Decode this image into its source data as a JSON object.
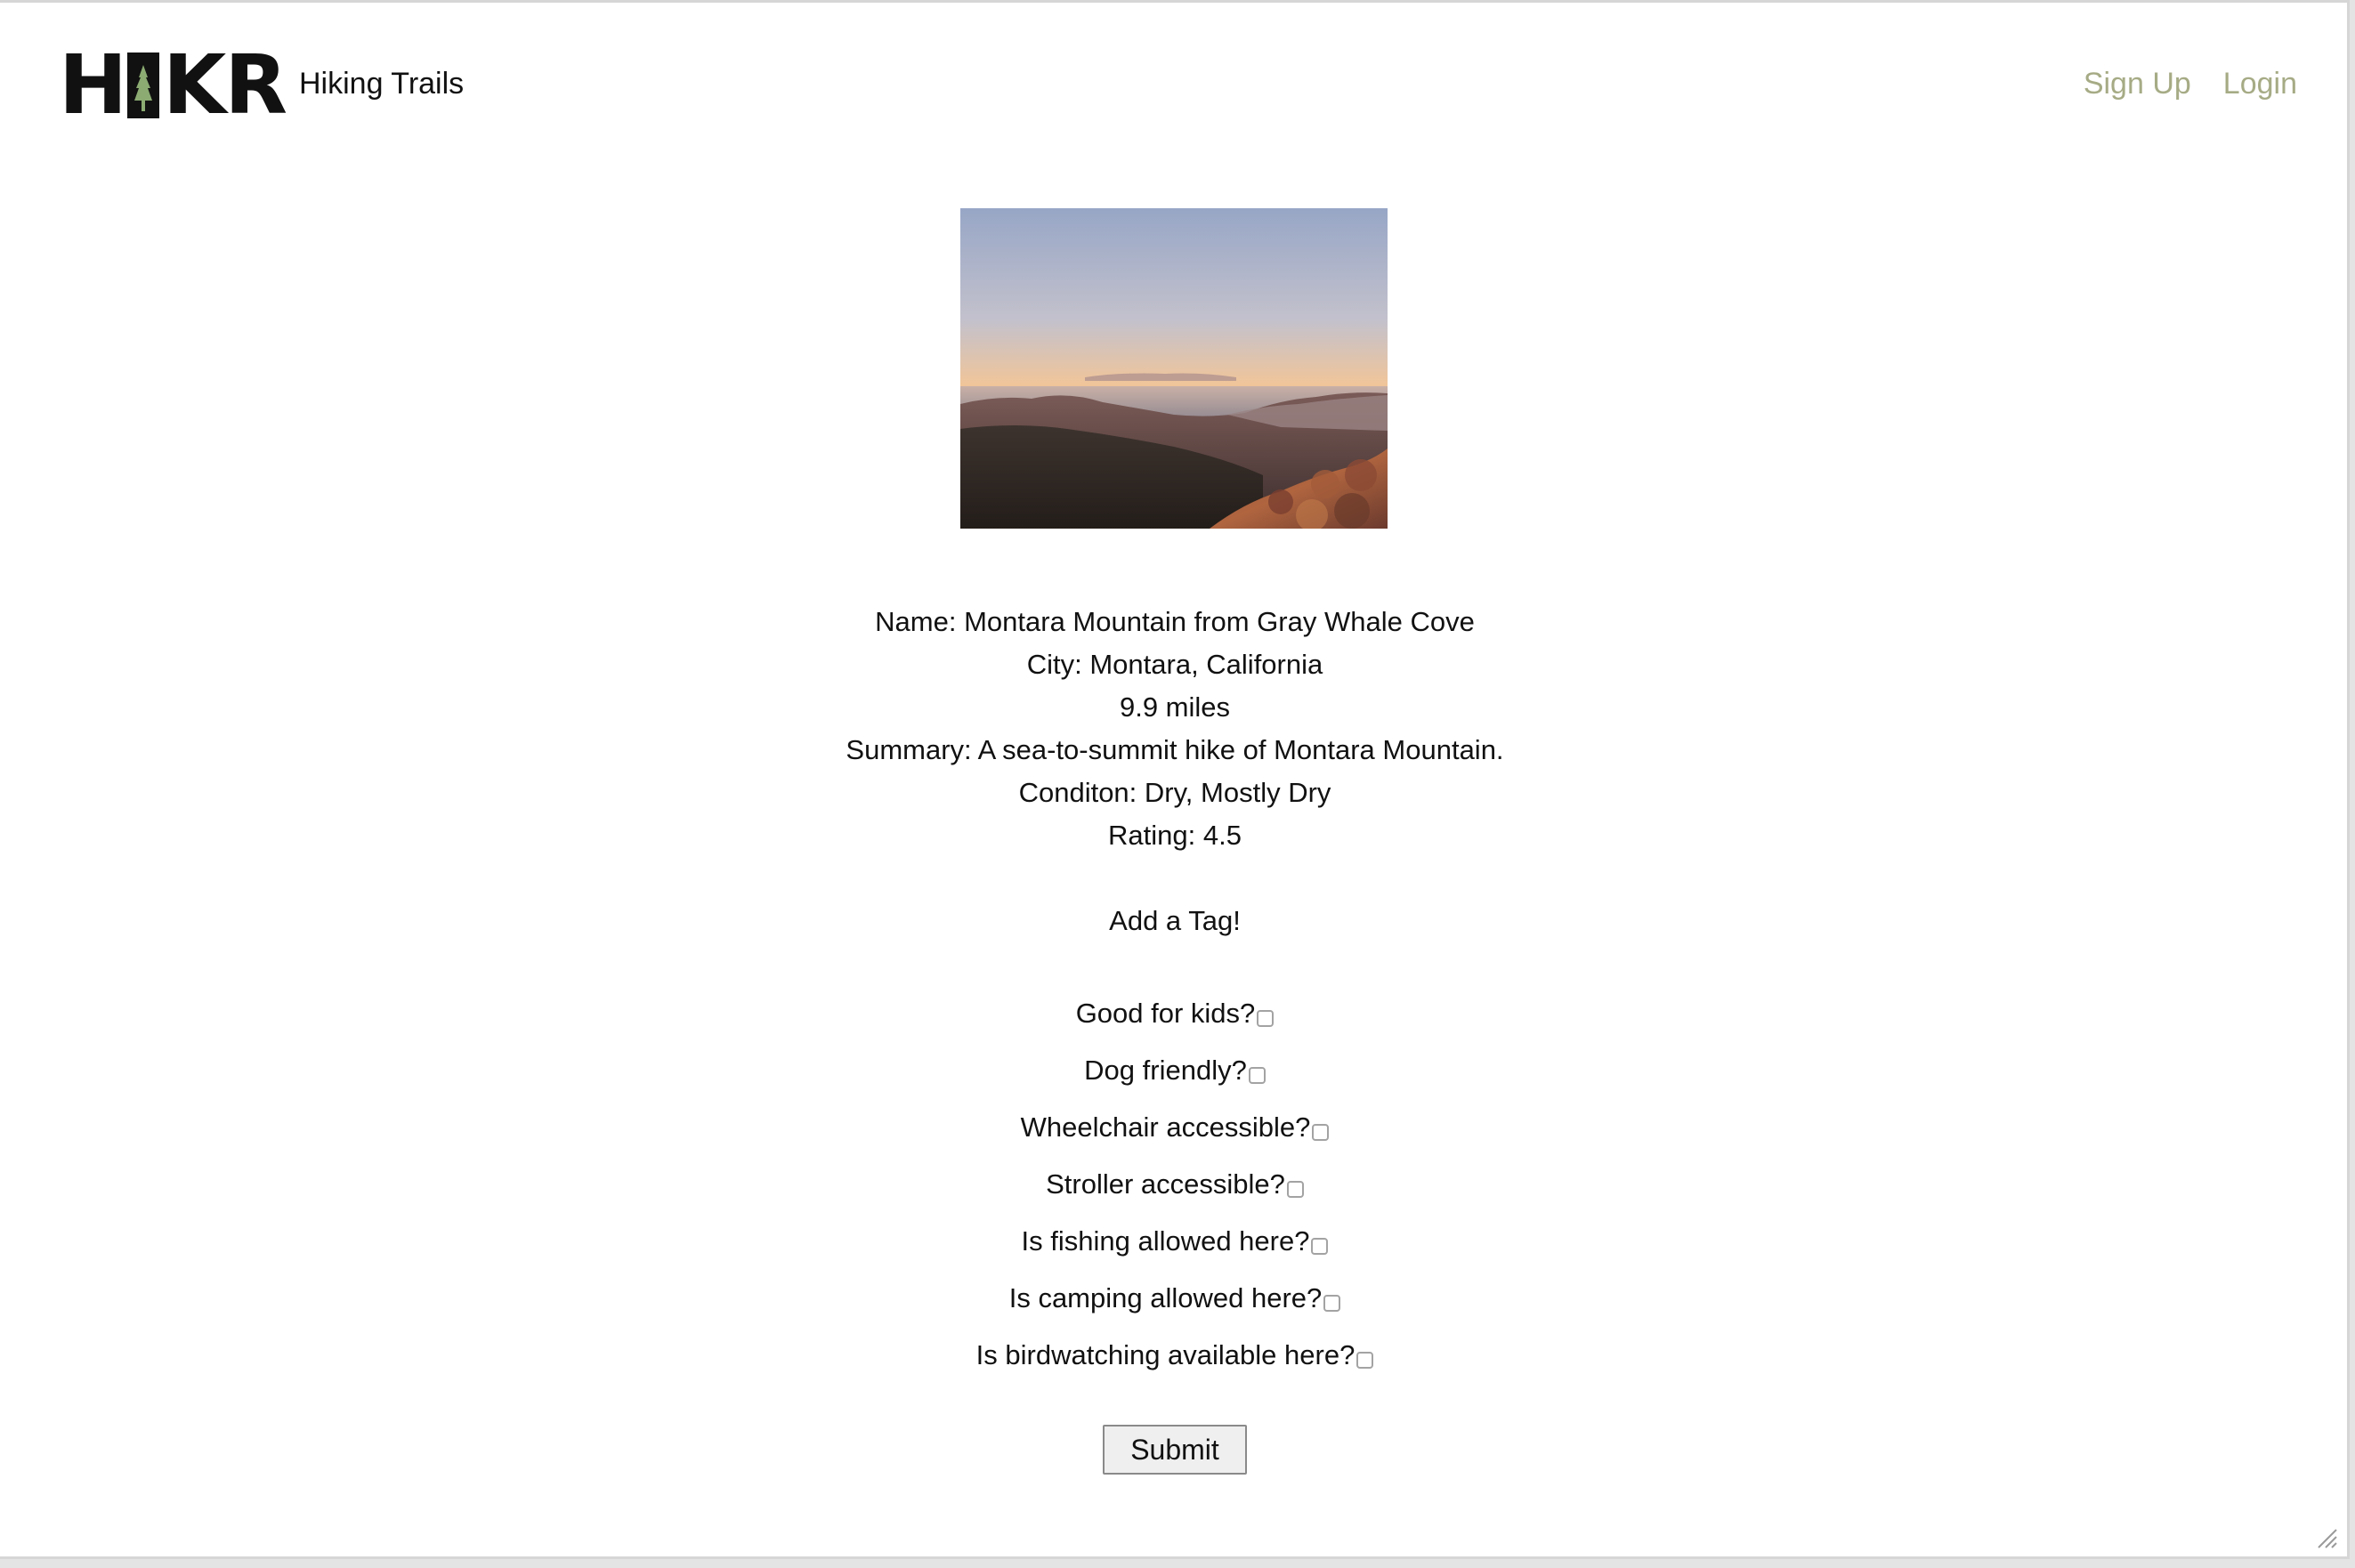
{
  "header": {
    "logo_letters": [
      "H",
      "I",
      "K",
      "R"
    ],
    "site_title": "Hiking Trails",
    "nav": {
      "signup": "Sign Up",
      "login": "Login"
    },
    "accent_color": "#a6ab85",
    "logo_tree_color": "#8bab72"
  },
  "trail": {
    "photo_icon": "sunset-landscape-image",
    "name_line": "Name: Montara Mountain from Gray Whale Cove",
    "city_line": "City: Montara, California",
    "distance_line": "9.9 miles",
    "summary_line": "Summary: A sea-to-summit hike of Montara Mountain.",
    "condition_line": "Conditon: Dry, Mostly Dry",
    "rating_line": "Rating: 4.5"
  },
  "tags": {
    "heading": "Add a Tag!",
    "options": [
      {
        "label": "Good for kids?",
        "checked": false
      },
      {
        "label": "Dog friendly?",
        "checked": false
      },
      {
        "label": "Wheelchair accessible?",
        "checked": false
      },
      {
        "label": "Stroller accessible?",
        "checked": false
      },
      {
        "label": "Is fishing allowed here?",
        "checked": false
      },
      {
        "label": "Is camping allowed here?",
        "checked": false
      },
      {
        "label": "Is birdwatching available here?",
        "checked": false
      }
    ],
    "submit_label": "Submit"
  }
}
